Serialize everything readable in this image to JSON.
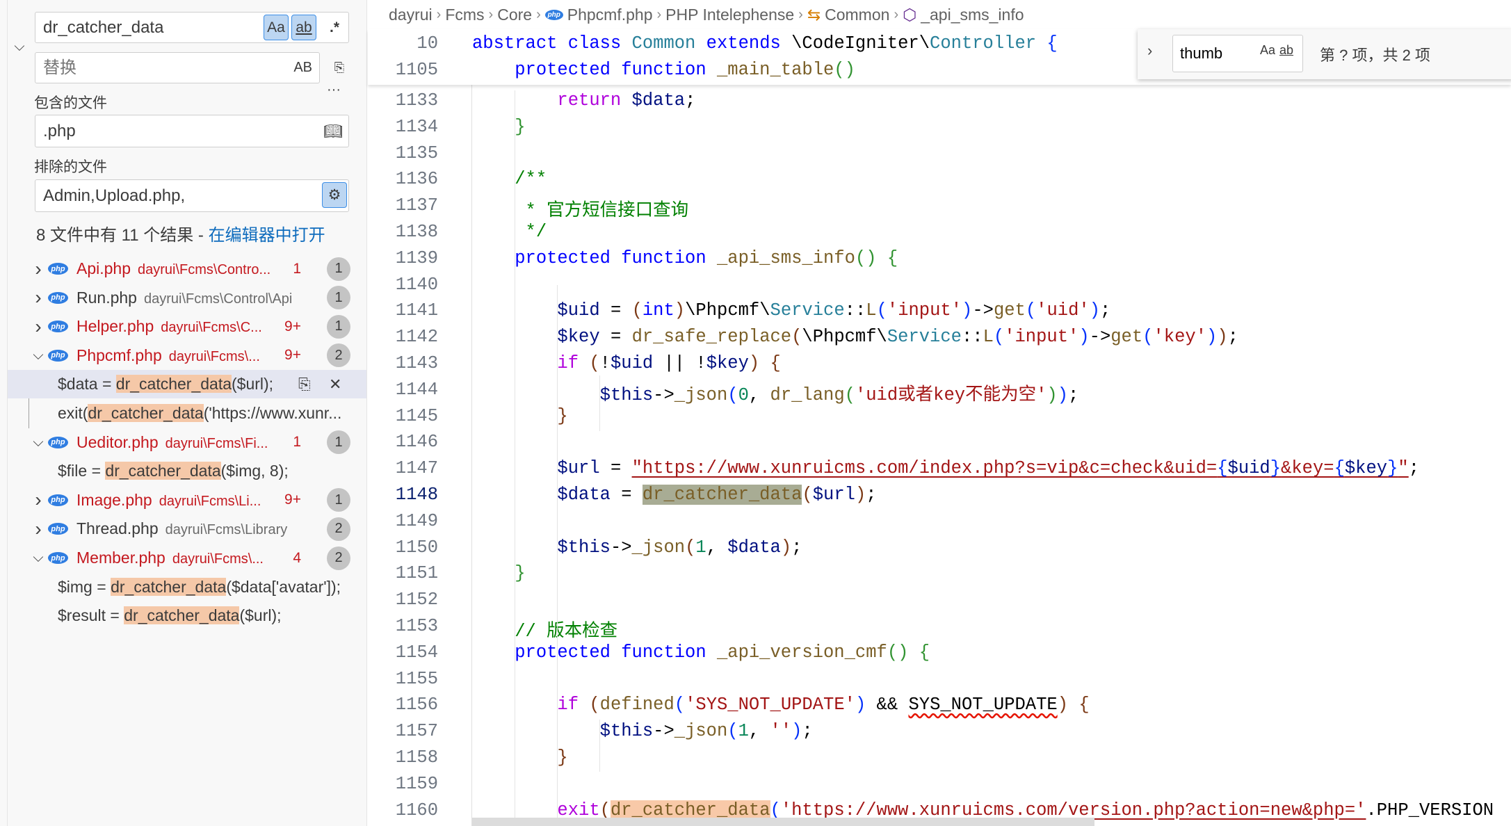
{
  "search": {
    "query": "dr_catcher_data",
    "replace_placeholder": "替换",
    "match_case": "Aa",
    "whole_word": "ab",
    "regex": ".*",
    "preserve_case": "AB",
    "include_label": "包含的文件",
    "include_value": ".php",
    "exclude_label": "排除的文件",
    "exclude_value": "Admin,Upload.php,",
    "summary": "8 文件中有 11 个结果 - ",
    "open_in_editor": "在编辑器中打开",
    "more": "···"
  },
  "results": [
    {
      "name": "Api.php",
      "path": "dayrui\\Fcms\\Contro...",
      "problems": "1",
      "badge": "1",
      "expanded": false,
      "error": true,
      "matches": []
    },
    {
      "name": "Run.php",
      "path": "dayrui\\Fcms\\Control\\Api",
      "problems": "",
      "badge": "1",
      "expanded": false,
      "error": false,
      "matches": []
    },
    {
      "name": "Helper.php",
      "path": "dayrui\\Fcms\\C...",
      "problems": "9+",
      "badge": "1",
      "expanded": false,
      "error": true,
      "matches": []
    },
    {
      "name": "Phpcmf.php",
      "path": "dayrui\\Fcms\\...",
      "problems": "9+",
      "badge": "2",
      "expanded": true,
      "error": true,
      "matches": [
        {
          "pre": "$data = ",
          "hit": "dr_catcher_data",
          "post": "($url);",
          "selected": true
        },
        {
          "pre": "exit(",
          "hit": "dr_catcher_data",
          "post": "('https://www.xunr...",
          "selected": false
        }
      ]
    },
    {
      "name": "Ueditor.php",
      "path": "dayrui\\Fcms\\Fi...",
      "problems": "1",
      "badge": "1",
      "expanded": true,
      "error": true,
      "matches": [
        {
          "pre": "$file = ",
          "hit": "dr_catcher_data",
          "post": "($img, 8);",
          "selected": false
        }
      ]
    },
    {
      "name": "Image.php",
      "path": "dayrui\\Fcms\\Li...",
      "problems": "9+",
      "badge": "1",
      "expanded": false,
      "error": true,
      "matches": []
    },
    {
      "name": "Thread.php",
      "path": "dayrui\\Fcms\\Library",
      "problems": "",
      "badge": "2",
      "expanded": false,
      "error": false,
      "matches": []
    },
    {
      "name": "Member.php",
      "path": "dayrui\\Fcms\\...",
      "problems": "4",
      "badge": "2",
      "expanded": true,
      "error": true,
      "matches": [
        {
          "pre": "$img = ",
          "hit": "dr_catcher_data",
          "post": "($data['avatar']);",
          "selected": false
        },
        {
          "pre": "$result = ",
          "hit": "dr_catcher_data",
          "post": "($url);",
          "selected": false
        }
      ]
    }
  ],
  "breadcrumb": [
    "dayrui",
    "Fcms",
    "Core",
    "Phpcmf.php",
    "PHP Intelephense",
    "Common",
    "_api_sms_info"
  ],
  "find_widget": {
    "value": "thumb",
    "match_case": "Aa",
    "whole_word": "ab",
    "regex": ".*",
    "result": "第 ? 项，共 2 项"
  },
  "current_line": "1148",
  "sticky": [
    {
      "ln": "10",
      "t": [
        [
          "k",
          "abstract class "
        ],
        [
          "c",
          "Common"
        ],
        [
          "k",
          " extends "
        ],
        [
          "p",
          "\\CodeIgniter\\"
        ],
        [
          "c",
          "Controller"
        ],
        [
          "p",
          " "
        ],
        [
          "b1",
          "{"
        ]
      ]
    },
    {
      "ln": "1105",
      "t": [
        [
          "p",
          "    "
        ],
        [
          "k",
          "protected function "
        ],
        [
          "f",
          "_main_table"
        ],
        [
          "b2",
          "()"
        ]
      ]
    }
  ],
  "code": [
    {
      "ln": "1133",
      "t": [
        [
          "p",
          "        "
        ],
        [
          "ctl",
          "return "
        ],
        [
          "v",
          "$data"
        ],
        [
          "p",
          ";"
        ]
      ]
    },
    {
      "ln": "1134",
      "t": [
        [
          "p",
          "    "
        ],
        [
          "b2",
          "}"
        ]
      ]
    },
    {
      "ln": "1135",
      "t": []
    },
    {
      "ln": "1136",
      "t": [
        [
          "p",
          "    "
        ],
        [
          "cm",
          "/**"
        ]
      ]
    },
    {
      "ln": "1137",
      "t": [
        [
          "cm",
          "     * 官方短信接口查询"
        ]
      ]
    },
    {
      "ln": "1138",
      "t": [
        [
          "cm",
          "     */"
        ]
      ]
    },
    {
      "ln": "1139",
      "t": [
        [
          "p",
          "    "
        ],
        [
          "k",
          "protected function "
        ],
        [
          "f",
          "_api_sms_info"
        ],
        [
          "b2",
          "()"
        ],
        [
          "p",
          " "
        ],
        [
          "b2",
          "{"
        ]
      ]
    },
    {
      "ln": "1140",
      "t": []
    },
    {
      "ln": "1141",
      "t": [
        [
          "p",
          "        "
        ],
        [
          "v",
          "$uid"
        ],
        [
          "p",
          " = "
        ],
        [
          "b3",
          "("
        ],
        [
          "k",
          "int"
        ],
        [
          "b3",
          ")"
        ],
        [
          "p",
          "\\Phpcmf\\"
        ],
        [
          "c",
          "Service"
        ],
        [
          "p",
          "::"
        ],
        [
          "f",
          "L"
        ],
        [
          "b1",
          "("
        ],
        [
          "s",
          "'input'"
        ],
        [
          "b1",
          ")"
        ],
        [
          "p",
          "->"
        ],
        [
          "f",
          "get"
        ],
        [
          "b1",
          "("
        ],
        [
          "s",
          "'uid'"
        ],
        [
          "b1",
          ")"
        ],
        [
          "p",
          ";"
        ]
      ]
    },
    {
      "ln": "1142",
      "t": [
        [
          "p",
          "        "
        ],
        [
          "v",
          "$key"
        ],
        [
          "p",
          " = "
        ],
        [
          "f",
          "dr_safe_replace"
        ],
        [
          "b3",
          "("
        ],
        [
          "p",
          "\\Phpcmf\\"
        ],
        [
          "c",
          "Service"
        ],
        [
          "p",
          "::"
        ],
        [
          "f",
          "L"
        ],
        [
          "b1",
          "("
        ],
        [
          "s",
          "'input'"
        ],
        [
          "b1",
          ")"
        ],
        [
          "p",
          "->"
        ],
        [
          "f",
          "get"
        ],
        [
          "b1",
          "("
        ],
        [
          "s",
          "'key'"
        ],
        [
          "b1",
          ")"
        ],
        [
          "b3",
          ")"
        ],
        [
          "p",
          ";"
        ]
      ]
    },
    {
      "ln": "1143",
      "t": [
        [
          "p",
          "        "
        ],
        [
          "ctl",
          "if "
        ],
        [
          "b3",
          "("
        ],
        [
          "p",
          "!"
        ],
        [
          "v",
          "$uid"
        ],
        [
          "p",
          " || !"
        ],
        [
          "v",
          "$key"
        ],
        [
          "b3",
          ")"
        ],
        [
          "p",
          " "
        ],
        [
          "b3",
          "{"
        ]
      ]
    },
    {
      "ln": "1144",
      "t": [
        [
          "p",
          "            "
        ],
        [
          "v",
          "$this"
        ],
        [
          "p",
          "->"
        ],
        [
          "f",
          "_json"
        ],
        [
          "b1",
          "("
        ],
        [
          "n",
          "0"
        ],
        [
          "p",
          ", "
        ],
        [
          "f",
          "dr_lang"
        ],
        [
          "b2",
          "("
        ],
        [
          "s",
          "'uid或者key不能为空'"
        ],
        [
          "b2",
          ")"
        ],
        [
          "b1",
          ")"
        ],
        [
          "p",
          ";"
        ]
      ]
    },
    {
      "ln": "1145",
      "t": [
        [
          "p",
          "        "
        ],
        [
          "b3",
          "}"
        ]
      ]
    },
    {
      "ln": "1146",
      "t": []
    },
    {
      "ln": "1147",
      "t": [
        [
          "p",
          "        "
        ],
        [
          "v",
          "$url"
        ],
        [
          "p",
          " = "
        ],
        [
          "s ul",
          "\"https://www.xunruicms.com/index.php?s=vip&c=check&uid="
        ],
        [
          "b1 ul",
          "{"
        ],
        [
          "v ul",
          "$uid"
        ],
        [
          "b1 ul",
          "}"
        ],
        [
          "s ul",
          "&key="
        ],
        [
          "b1 ul",
          "{"
        ],
        [
          "v ul",
          "$key"
        ],
        [
          "b1 ul",
          "}"
        ],
        [
          "s ul",
          "\""
        ],
        [
          "p",
          ";"
        ]
      ]
    },
    {
      "ln": "1148",
      "t": [
        [
          "p",
          "        "
        ],
        [
          "v",
          "$data"
        ],
        [
          "p",
          " = "
        ],
        [
          "f mc",
          "dr_catcher_data"
        ],
        [
          "b3",
          "("
        ],
        [
          "v",
          "$url"
        ],
        [
          "b3",
          ")"
        ],
        [
          "p",
          ";"
        ]
      ]
    },
    {
      "ln": "1149",
      "t": []
    },
    {
      "ln": "1150",
      "t": [
        [
          "p",
          "        "
        ],
        [
          "v",
          "$this"
        ],
        [
          "p",
          "->"
        ],
        [
          "f",
          "_json"
        ],
        [
          "b3",
          "("
        ],
        [
          "n",
          "1"
        ],
        [
          "p",
          ", "
        ],
        [
          "v",
          "$data"
        ],
        [
          "b3",
          ")"
        ],
        [
          "p",
          ";"
        ]
      ]
    },
    {
      "ln": "1151",
      "t": [
        [
          "p",
          "    "
        ],
        [
          "b2",
          "}"
        ]
      ]
    },
    {
      "ln": "1152",
      "t": []
    },
    {
      "ln": "1153",
      "t": [
        [
          "p",
          "    "
        ],
        [
          "cm",
          "// 版本检查"
        ]
      ]
    },
    {
      "ln": "1154",
      "t": [
        [
          "p",
          "    "
        ],
        [
          "k",
          "protected function "
        ],
        [
          "f",
          "_api_version_cmf"
        ],
        [
          "b2",
          "()"
        ],
        [
          "p",
          " "
        ],
        [
          "b2",
          "{"
        ]
      ]
    },
    {
      "ln": "1155",
      "t": []
    },
    {
      "ln": "1156",
      "t": [
        [
          "p",
          "        "
        ],
        [
          "ctl",
          "if "
        ],
        [
          "b3",
          "("
        ],
        [
          "f",
          "defined"
        ],
        [
          "b1",
          "("
        ],
        [
          "s",
          "'SYS_NOT_UPDATE'"
        ],
        [
          "b1",
          ")"
        ],
        [
          "p",
          " && "
        ],
        [
          "p sq",
          "SYS_NOT_UPDATE"
        ],
        [
          "b3",
          ")"
        ],
        [
          "p",
          " "
        ],
        [
          "b3",
          "{"
        ]
      ]
    },
    {
      "ln": "1157",
      "t": [
        [
          "p",
          "            "
        ],
        [
          "v",
          "$this"
        ],
        [
          "p",
          "->"
        ],
        [
          "f",
          "_json"
        ],
        [
          "b1",
          "("
        ],
        [
          "n",
          "1"
        ],
        [
          "p",
          ", "
        ],
        [
          "s",
          "''"
        ],
        [
          "b1",
          ")"
        ],
        [
          "p",
          ";"
        ]
      ]
    },
    {
      "ln": "1158",
      "t": [
        [
          "p",
          "        "
        ],
        [
          "b3",
          "}"
        ]
      ]
    },
    {
      "ln": "1159",
      "t": []
    },
    {
      "ln": "1160",
      "t": [
        [
          "p",
          "        "
        ],
        [
          "ctl",
          "exit"
        ],
        [
          "b3",
          "("
        ],
        [
          "f m",
          "dr_catcher_data"
        ],
        [
          "b1",
          "("
        ],
        [
          "s ul",
          "'https://www.xunruicms.com/version.php?action=new&php='"
        ],
        [
          "p",
          ".PHP_VERSION"
        ]
      ]
    }
  ]
}
